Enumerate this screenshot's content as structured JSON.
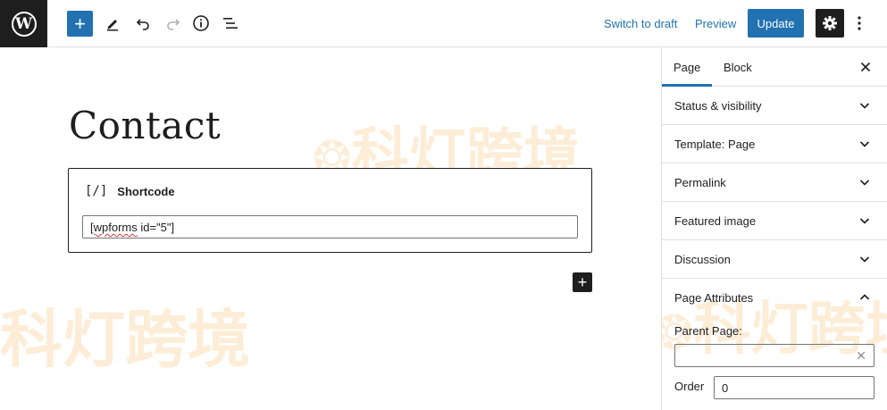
{
  "topbar": {
    "logo_letter": "W",
    "switch_to_draft": "Switch to draft",
    "preview": "Preview",
    "update": "Update"
  },
  "editor": {
    "page_title": "Contact",
    "block": {
      "icon_text": "[/]",
      "label": "Shortcode",
      "value_word": "[wpforms",
      "value_rest": " id=\"5\"]"
    }
  },
  "watermark": {
    "text": "科灯跨境"
  },
  "sidebar": {
    "tabs": [
      "Page",
      "Block"
    ],
    "panels": [
      {
        "title": "Status & visibility"
      },
      {
        "title": "Template: Page"
      },
      {
        "title": "Permalink"
      },
      {
        "title": "Featured image"
      },
      {
        "title": "Discussion"
      }
    ],
    "page_attributes": {
      "title": "Page Attributes",
      "parent_label": "Parent Page:",
      "order_label": "Order",
      "order_value": "0"
    }
  },
  "colors": {
    "accent": "#2271b1",
    "dark": "#1e1e1e",
    "border": "#e0e0e0",
    "watermark": "#f6ab48"
  }
}
